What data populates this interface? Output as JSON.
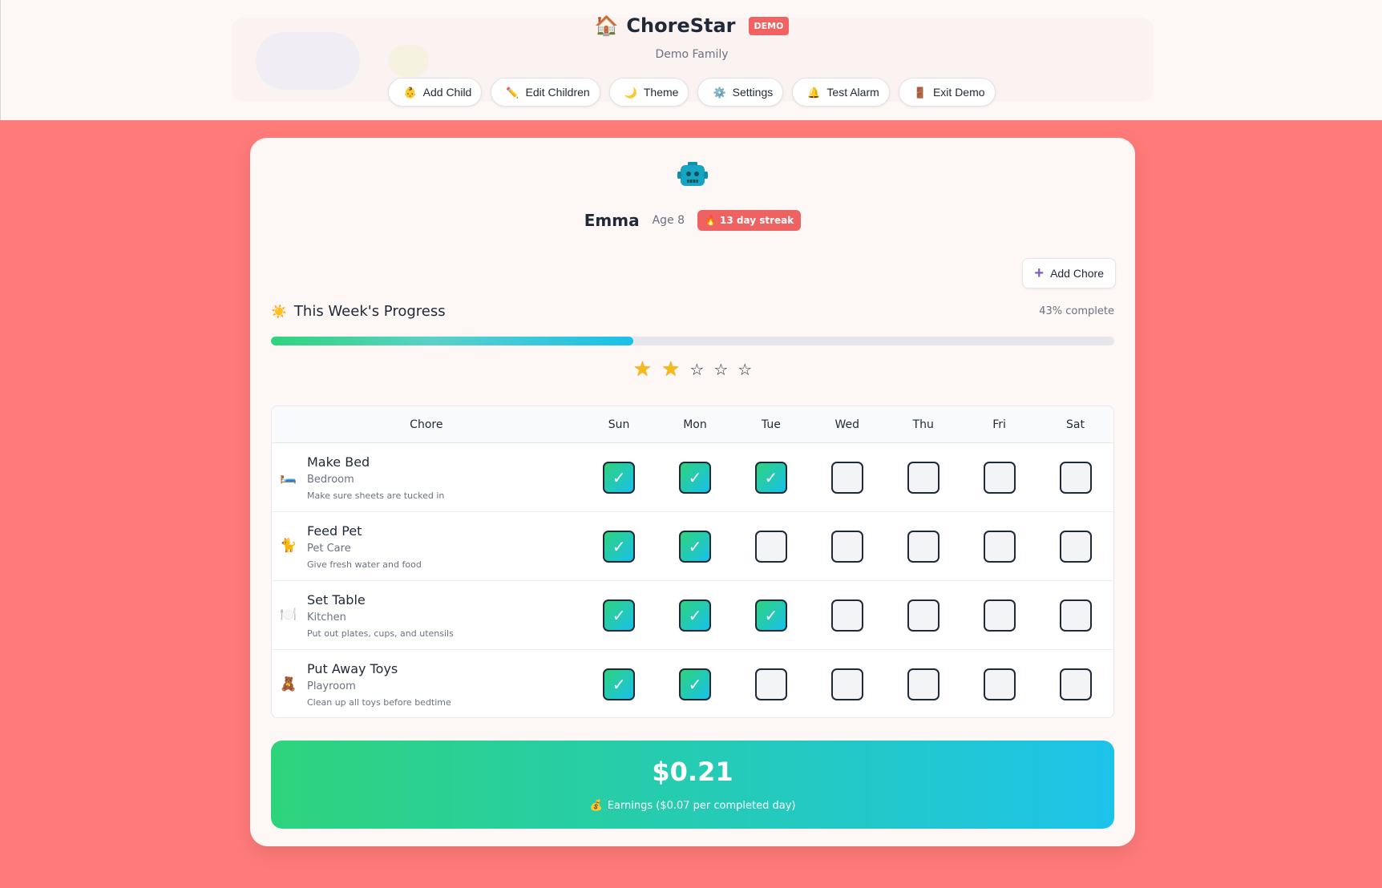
{
  "header": {
    "app_icon": "house-icon",
    "app_icon_glyph": "🏠",
    "title": "ChoreStar",
    "badge": "DEMO",
    "family_name": "Demo Family",
    "nav": [
      {
        "label": "Add Child",
        "icon": "baby-icon",
        "glyph": "👶"
      },
      {
        "label": "Edit Children",
        "icon": "pencil-icon",
        "glyph": "✏️"
      },
      {
        "label": "Theme",
        "icon": "moon-icon",
        "glyph": "🌙"
      },
      {
        "label": "Settings",
        "icon": "gear-icon",
        "glyph": "⚙️"
      },
      {
        "label": "Test Alarm",
        "icon": "bell-icon",
        "glyph": "🔔"
      },
      {
        "label": "Exit Demo",
        "icon": "door-icon",
        "glyph": "🚪"
      }
    ]
  },
  "child": {
    "avatar_icon": "robot-icon",
    "name": "Emma",
    "age": "Age 8",
    "streak_icon": "fire-icon",
    "streak_glyph": "🔥",
    "streak": "13 day streak"
  },
  "add_chore_label": "Add Chore",
  "progress": {
    "icon": "sun-icon",
    "glyph": "☀️",
    "title": "This Week's Progress",
    "percent_label": "43% complete",
    "fraction": 0.43,
    "stars_filled": 2,
    "stars_total": 5
  },
  "table": {
    "chore_header": "Chore",
    "days": [
      "Sun",
      "Mon",
      "Tue",
      "Wed",
      "Thu",
      "Fri",
      "Sat"
    ],
    "chores": [
      {
        "name": "Make Bed",
        "room": "Bedroom",
        "desc": "Make sure sheets are tucked in",
        "icon": "bed-icon",
        "glyph": "🛏️",
        "done": [
          true,
          true,
          true,
          false,
          false,
          false,
          false
        ]
      },
      {
        "name": "Feed Pet",
        "room": "Pet Care",
        "desc": "Give fresh water and food",
        "icon": "cat-icon",
        "glyph": "🐈",
        "done": [
          true,
          true,
          false,
          false,
          false,
          false,
          false
        ]
      },
      {
        "name": "Set Table",
        "room": "Kitchen",
        "desc": "Put out plates, cups, and utensils",
        "icon": "plate-icon",
        "glyph": "🍽️",
        "done": [
          true,
          true,
          true,
          false,
          false,
          false,
          false
        ]
      },
      {
        "name": "Put Away Toys",
        "room": "Playroom",
        "desc": "Clean up all toys before bedtime",
        "icon": "teddy-bear-icon",
        "glyph": "🧸",
        "done": [
          true,
          true,
          false,
          false,
          false,
          false,
          false
        ]
      }
    ],
    "check_glyph": "✓"
  },
  "earnings": {
    "amount": "$0.21",
    "icon": "money-bag-icon",
    "glyph": "💰",
    "label": "Earnings ($0.07 per completed day)"
  },
  "colors": {
    "background": "#ff7b7a",
    "accent_green": "#2ed47c",
    "accent_cyan": "#19c0ea",
    "badge_red": "#f26262",
    "star_gold": "#f5b919"
  }
}
